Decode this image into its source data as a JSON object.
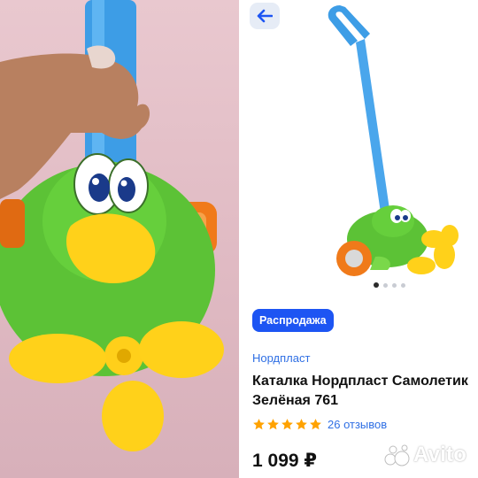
{
  "card": {
    "sale_badge": "Распродажа",
    "brand": "Нордпласт",
    "title": "Каталка Нордпласт Самолетик Зелёная 761",
    "rating": {
      "stars": 5,
      "reviews_label": "26 отзывов"
    },
    "price": "1 099 ₽",
    "gallery": {
      "total": 4,
      "active_index": 0
    }
  },
  "watermark": {
    "text": "Avito"
  },
  "colors": {
    "accent_blue": "#1d55f3",
    "link_blue": "#2f6fe4",
    "star_orange": "#ffa200",
    "back_button_bg": "#e6ecf6",
    "back_arrow": "#1d55f3",
    "photo_background": "#e3bec7"
  },
  "icons": {
    "back": "arrow-left-icon",
    "star": "star-icon",
    "avito_logo": "avito-logo-icon"
  }
}
